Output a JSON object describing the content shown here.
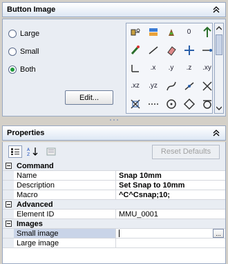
{
  "button_image": {
    "title": "Button Image",
    "size_options": [
      {
        "label": "Large",
        "selected": false
      },
      {
        "label": "Small",
        "selected": false
      },
      {
        "label": "Both",
        "selected": true
      }
    ],
    "edit_label": "Edit...",
    "icons": [
      {
        "name": "block-icon",
        "text": ""
      },
      {
        "name": "layer-icon",
        "text": ""
      },
      {
        "name": "paint-icon",
        "text": ""
      },
      {
        "name": "point-filter-icon",
        "text": "0"
      },
      {
        "name": "pointer-icon",
        "text": ""
      },
      {
        "name": "brush-icon",
        "text": ""
      },
      {
        "name": "line-icon",
        "text": ""
      },
      {
        "name": "eraser-icon",
        "text": ""
      },
      {
        "name": "move-icon",
        "text": ""
      },
      {
        "name": "arrow-point-icon",
        "text": ""
      },
      {
        "name": "ucs-icon",
        "text": ""
      },
      {
        "name": "filter-x-icon",
        "text": ".x"
      },
      {
        "name": "filter-y-icon",
        "text": ".y"
      },
      {
        "name": "filter-z-icon",
        "text": ".z"
      },
      {
        "name": "filter-xy-icon",
        "text": ".xy"
      },
      {
        "name": "filter-xz-icon",
        "text": ".xz"
      },
      {
        "name": "filter-yz-icon",
        "text": ".yz"
      },
      {
        "name": "curve-icon",
        "text": ""
      },
      {
        "name": "spline-icon",
        "text": ""
      },
      {
        "name": "intersection-icon",
        "text": ""
      },
      {
        "name": "apparent-intersection-icon",
        "text": ""
      },
      {
        "name": "extension-icon",
        "text": ""
      },
      {
        "name": "center-icon",
        "text": ""
      },
      {
        "name": "quadrant-icon",
        "text": ""
      },
      {
        "name": "tangent-icon",
        "text": ""
      },
      {
        "name": "perpendicular-icon",
        "text": ""
      },
      {
        "name": "parallel-icon",
        "text": ""
      },
      {
        "name": "node-icon",
        "text": ""
      },
      {
        "name": "insert-icon",
        "text": ""
      },
      {
        "name": "nearest-icon",
        "text": ""
      }
    ]
  },
  "properties": {
    "title": "Properties",
    "reset_label": "Reset Defaults",
    "sections": [
      {
        "label": "Command",
        "rows": [
          {
            "name": "Name",
            "value": "Snap 10mm",
            "bold": true
          },
          {
            "name": "Description",
            "value": "Set Snap to 10mm",
            "bold": true
          },
          {
            "name": "Macro",
            "value": "^C^Csnap;10;",
            "bold": true
          }
        ]
      },
      {
        "label": "Advanced",
        "rows": [
          {
            "name": "Element ID",
            "value": "MMU_0001",
            "bold": false
          }
        ]
      },
      {
        "label": "Images",
        "rows": [
          {
            "name": "Small image",
            "value": "",
            "bold": false,
            "selected": true
          },
          {
            "name": "Large image",
            "value": "",
            "bold": false
          }
        ]
      }
    ]
  }
}
